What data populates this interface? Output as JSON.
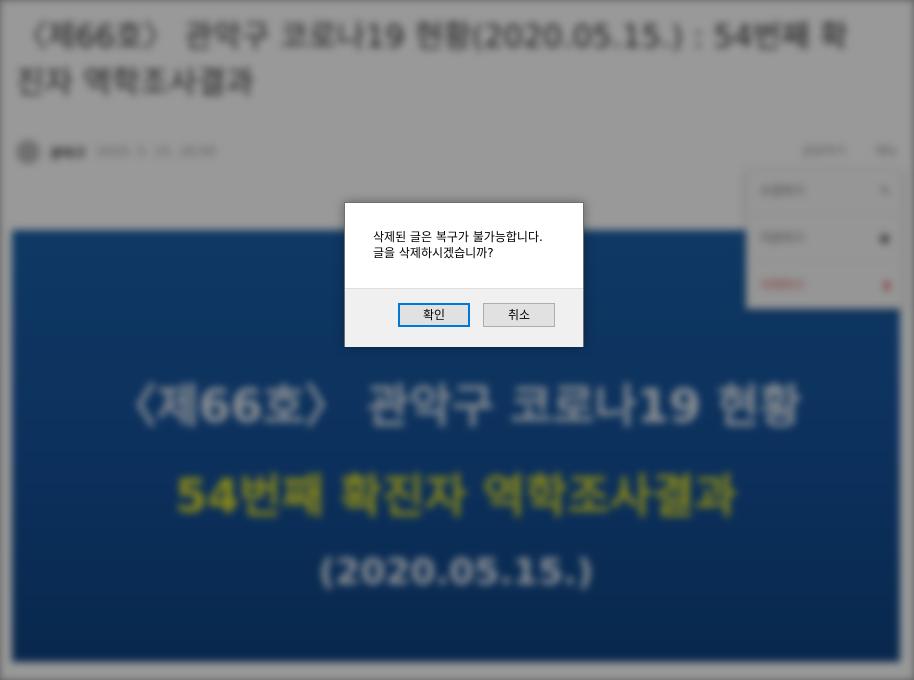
{
  "background": {
    "title": "〈제66호〉 관악구 코로나19 현황(2020.05.15.) : 54번째 확진자 역학조사결과",
    "author": "관악구",
    "date": "2020. 5. 15. 18:00",
    "actions": [
      "공유하기",
      "메뉴"
    ],
    "banner": {
      "line1": "〈제66호〉 관악구 코로나19 현황",
      "line2": "54번째 확진자 역학조사결과",
      "line3": "(2020.05.15.)"
    },
    "menu": {
      "items": [
        "수정하기",
        "저장하기",
        "삭제하기"
      ]
    }
  },
  "dialog": {
    "message_line1": "삭제된 글은 복구가 불가능합니다.",
    "message_line2": "글을 삭제하시겠습니까?",
    "ok_label": "확인",
    "cancel_label": "취소"
  },
  "colors": {
    "banner_blue": "#134f97",
    "banner_yellow": "#e4e02a",
    "focus_border": "#0078d7"
  }
}
